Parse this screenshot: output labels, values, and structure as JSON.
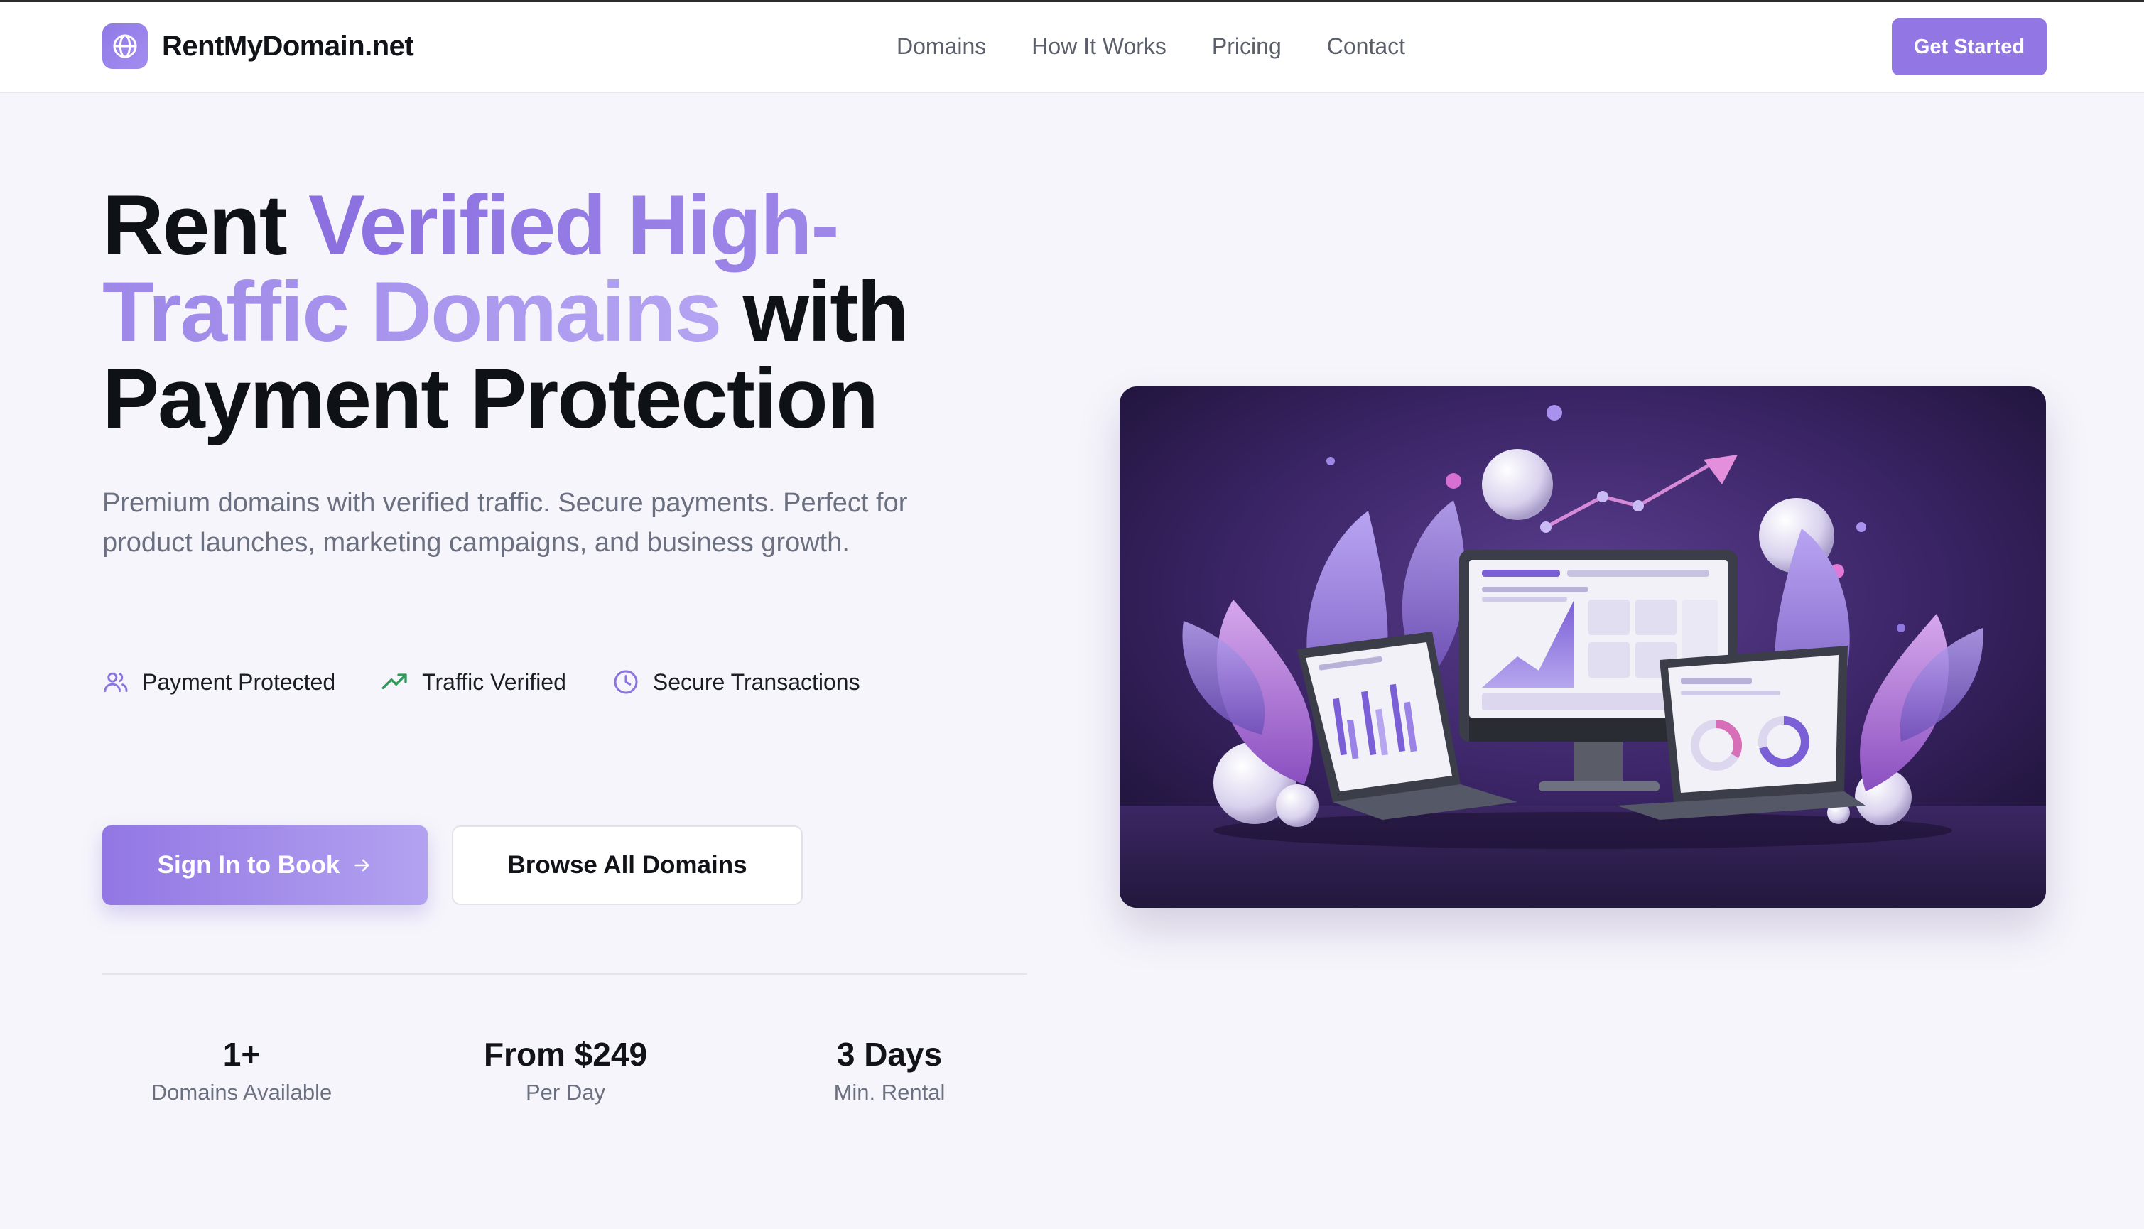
{
  "brand": {
    "name": "RentMyDomain.net",
    "logo_icon": "globe-icon"
  },
  "nav": {
    "items": [
      {
        "label": "Domains"
      },
      {
        "label": "How It Works"
      },
      {
        "label": "Pricing"
      },
      {
        "label": "Contact"
      }
    ],
    "cta": "Get Started"
  },
  "hero": {
    "title_part1": "Rent ",
    "title_accent": "Verified High-Traffic Domains",
    "title_part2": " with Payment Protection",
    "subtitle": "Premium domains with verified traffic. Secure payments. Perfect for product launches, marketing campaigns, and business growth.",
    "features": [
      {
        "icon": "users-icon",
        "label": "Payment Protected"
      },
      {
        "icon": "trending-up-icon",
        "label": "Traffic Verified"
      },
      {
        "icon": "clock-icon",
        "label": "Secure Transactions"
      }
    ],
    "primary_button": "Sign In to Book",
    "secondary_button": "Browse All Domains"
  },
  "stats": [
    {
      "value": "1+",
      "label": "Domains Available"
    },
    {
      "value": "From $249",
      "label": "Per Day"
    },
    {
      "value": "3 Days",
      "label": "Min. Rental"
    }
  ],
  "colors": {
    "accent": "#9277e4",
    "accent_light": "#b3a2f0",
    "page_bg": "#f6f5fb",
    "hero_image_bg": "#2a1a48"
  }
}
